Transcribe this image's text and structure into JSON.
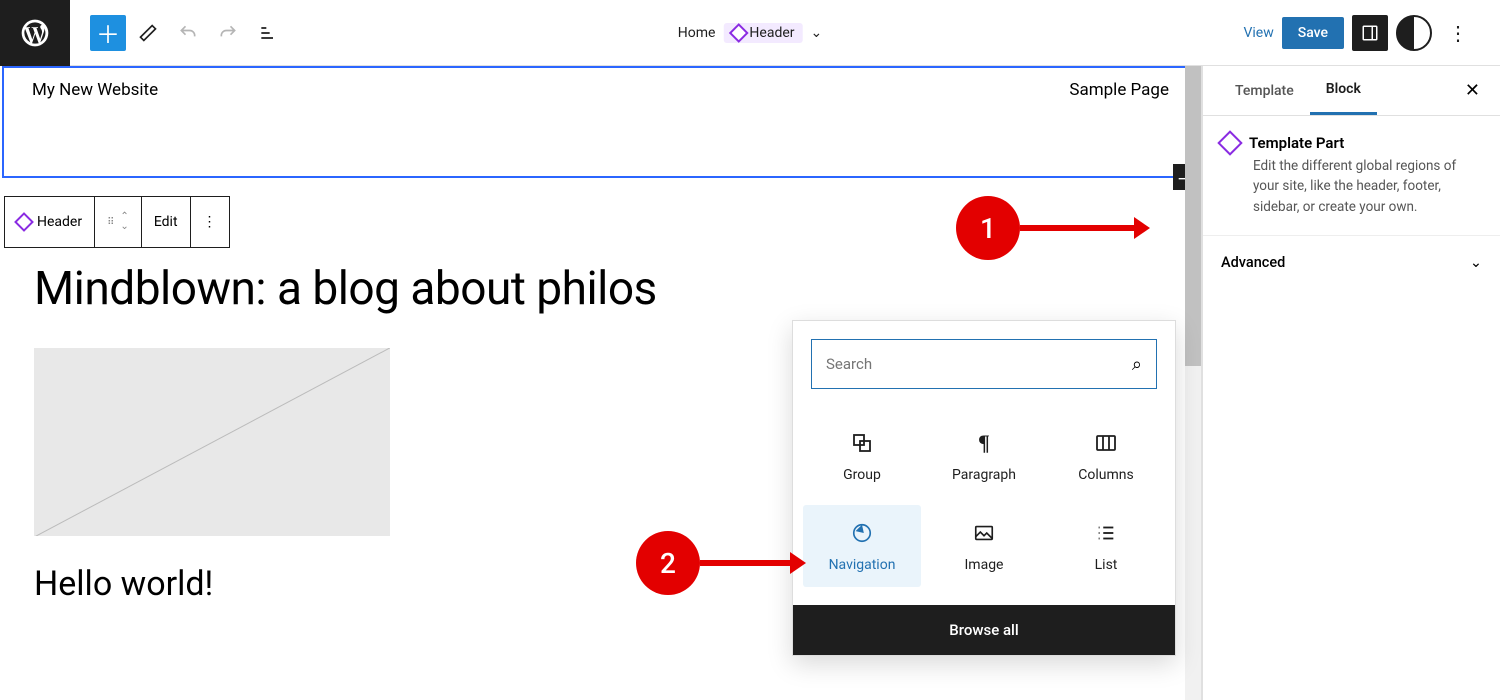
{
  "topbar": {
    "crumb_home": "Home",
    "crumb_header": "Header",
    "view_label": "View",
    "save_label": "Save"
  },
  "canvas": {
    "site_title": "My New Website",
    "nav_item": "Sample Page",
    "blog_title": "Mindblown: a blog about philos",
    "post_title": "Hello world!"
  },
  "block_toolbar": {
    "label": "Header",
    "edit_label": "Edit"
  },
  "inserter": {
    "search_placeholder": "Search",
    "browse_all": "Browse all",
    "items": [
      {
        "name": "Group"
      },
      {
        "name": "Paragraph"
      },
      {
        "name": "Columns"
      },
      {
        "name": "Navigation"
      },
      {
        "name": "Image"
      },
      {
        "name": "List"
      }
    ]
  },
  "sidebar": {
    "tab_template": "Template",
    "tab_block": "Block",
    "section_title": "Template Part",
    "section_desc": "Edit the different global regions of your site, like the header, footer, sidebar, or create your own.",
    "advanced": "Advanced"
  },
  "annotations": {
    "one": "1",
    "two": "2"
  }
}
